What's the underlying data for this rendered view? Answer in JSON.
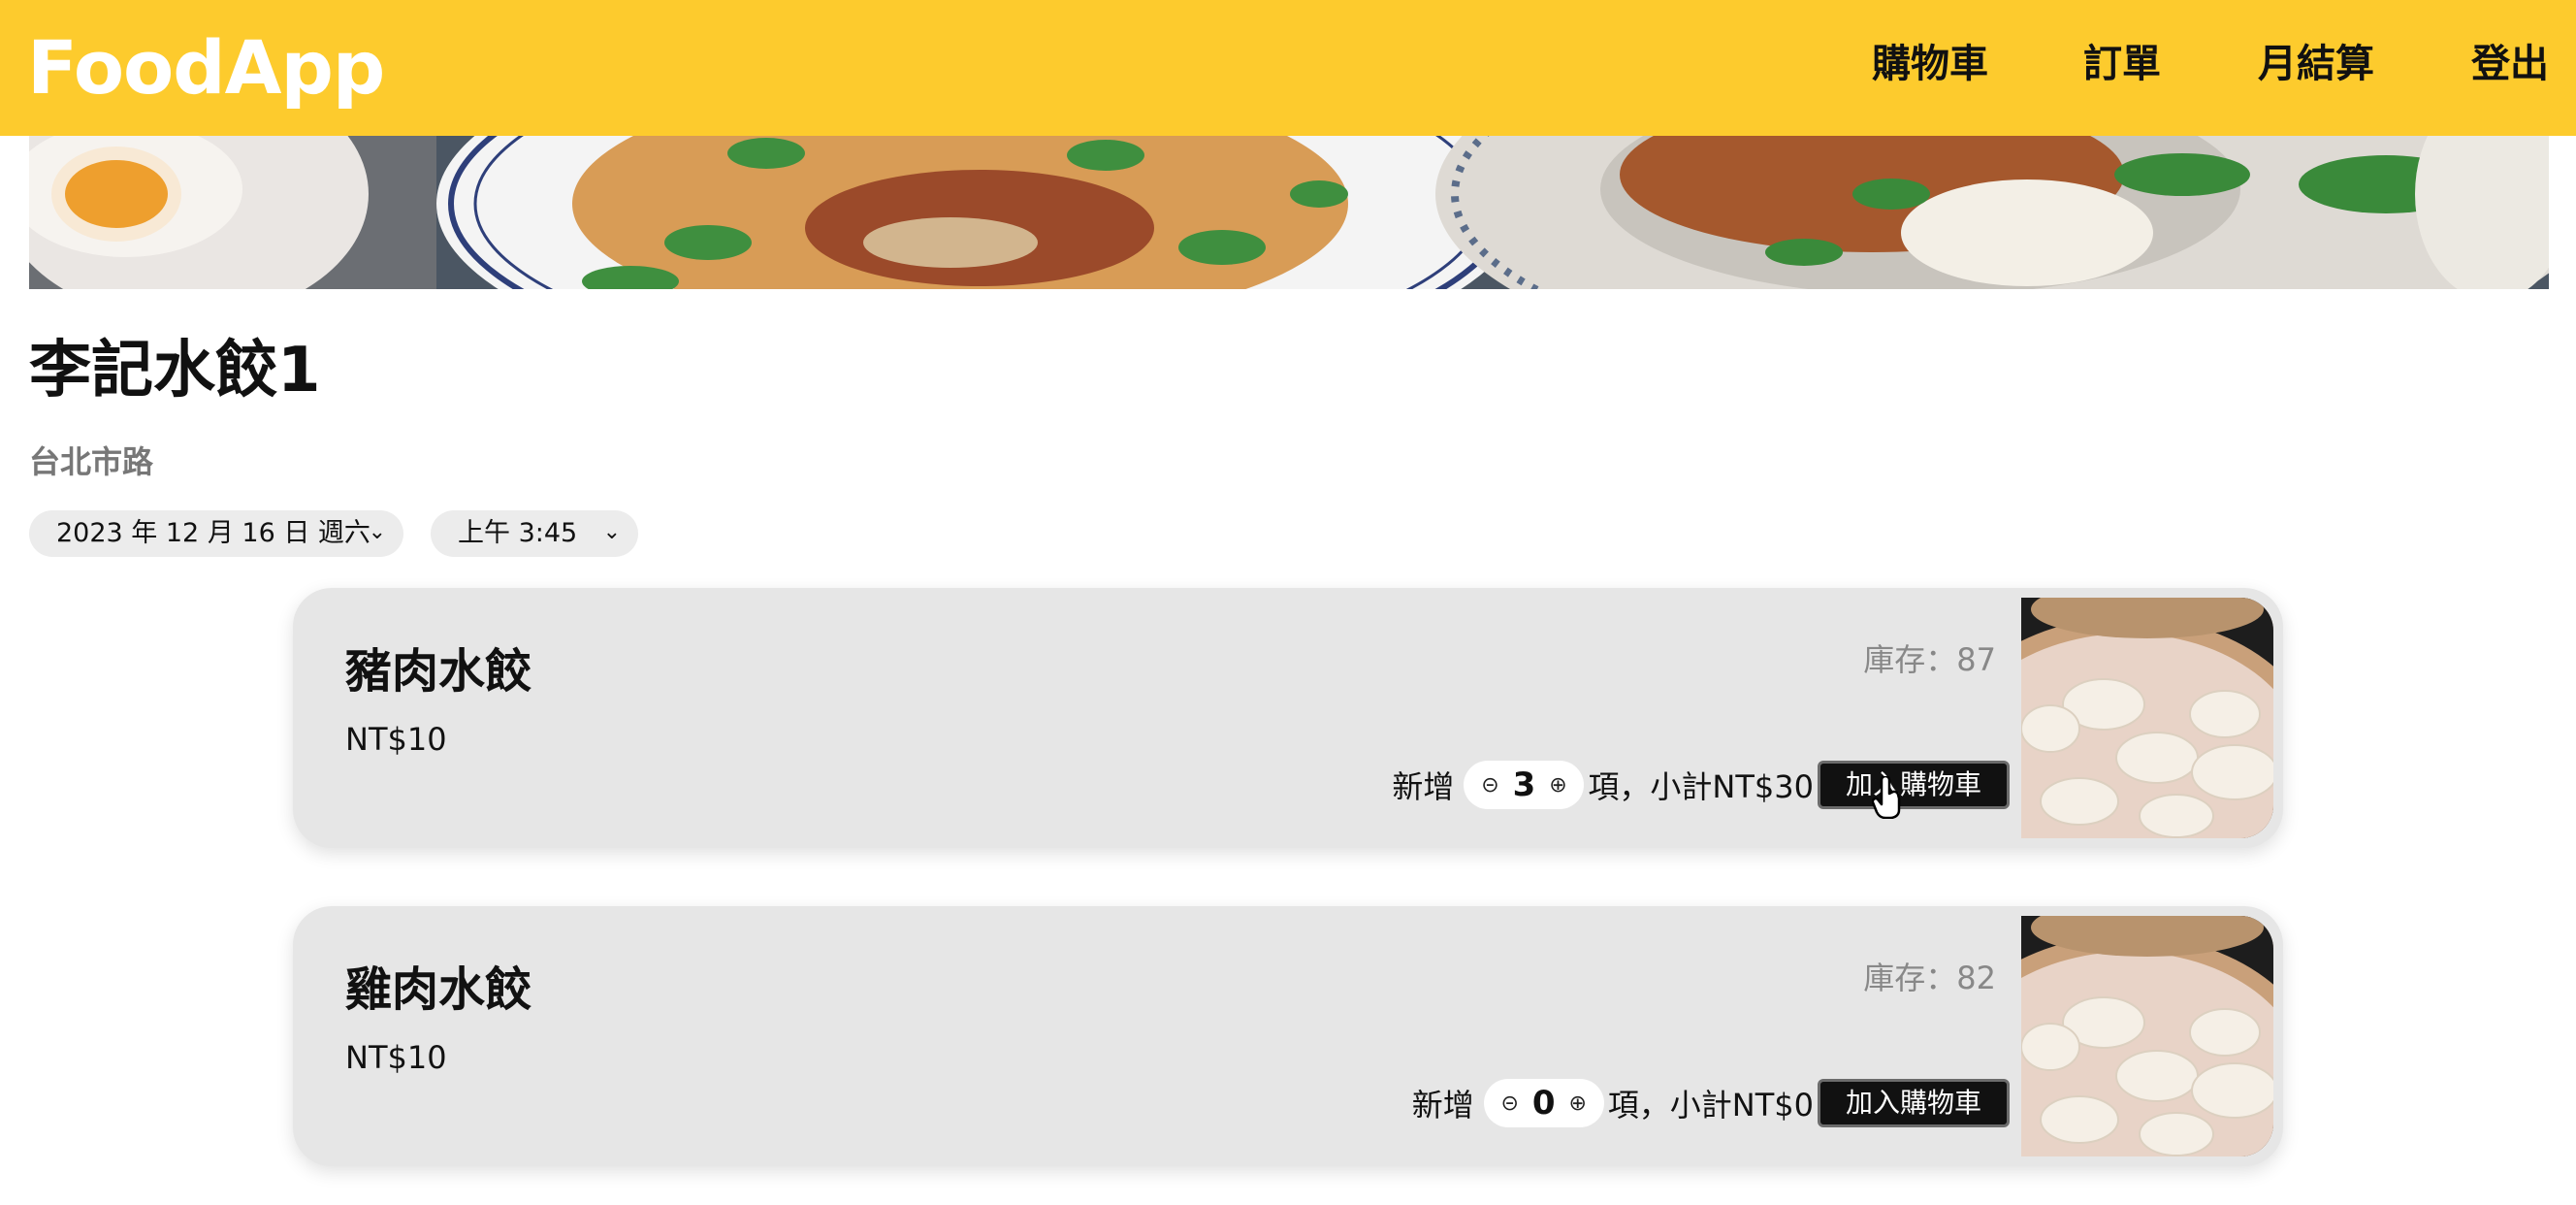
{
  "header": {
    "brand": "FoodApp",
    "nav": [
      "購物車",
      "訂單",
      "月結算",
      "登出"
    ],
    "background": "#fdcb2d"
  },
  "restaurant": {
    "name": "李記水餃1",
    "address": "台北市路"
  },
  "filters": {
    "date_value": "2023 年 12 月 16 日 週六",
    "time_value": "上午 3:45"
  },
  "products": [
    {
      "name": "豬肉水餃",
      "price": "NT$10",
      "stock": "庫存：87",
      "add_label": "新增",
      "quantity": "3",
      "subtotal": "項，小計NT$30",
      "button": "加入購物車"
    },
    {
      "name": "雞肉水餃",
      "price": "NT$10",
      "stock": "庫存：82",
      "add_label": "新增",
      "quantity": "0",
      "subtotal": "項，小計NT$0",
      "button": "加入購物車"
    }
  ],
  "icons": {
    "minus": "⊝",
    "plus": "⊕",
    "chevron": "⌄"
  }
}
